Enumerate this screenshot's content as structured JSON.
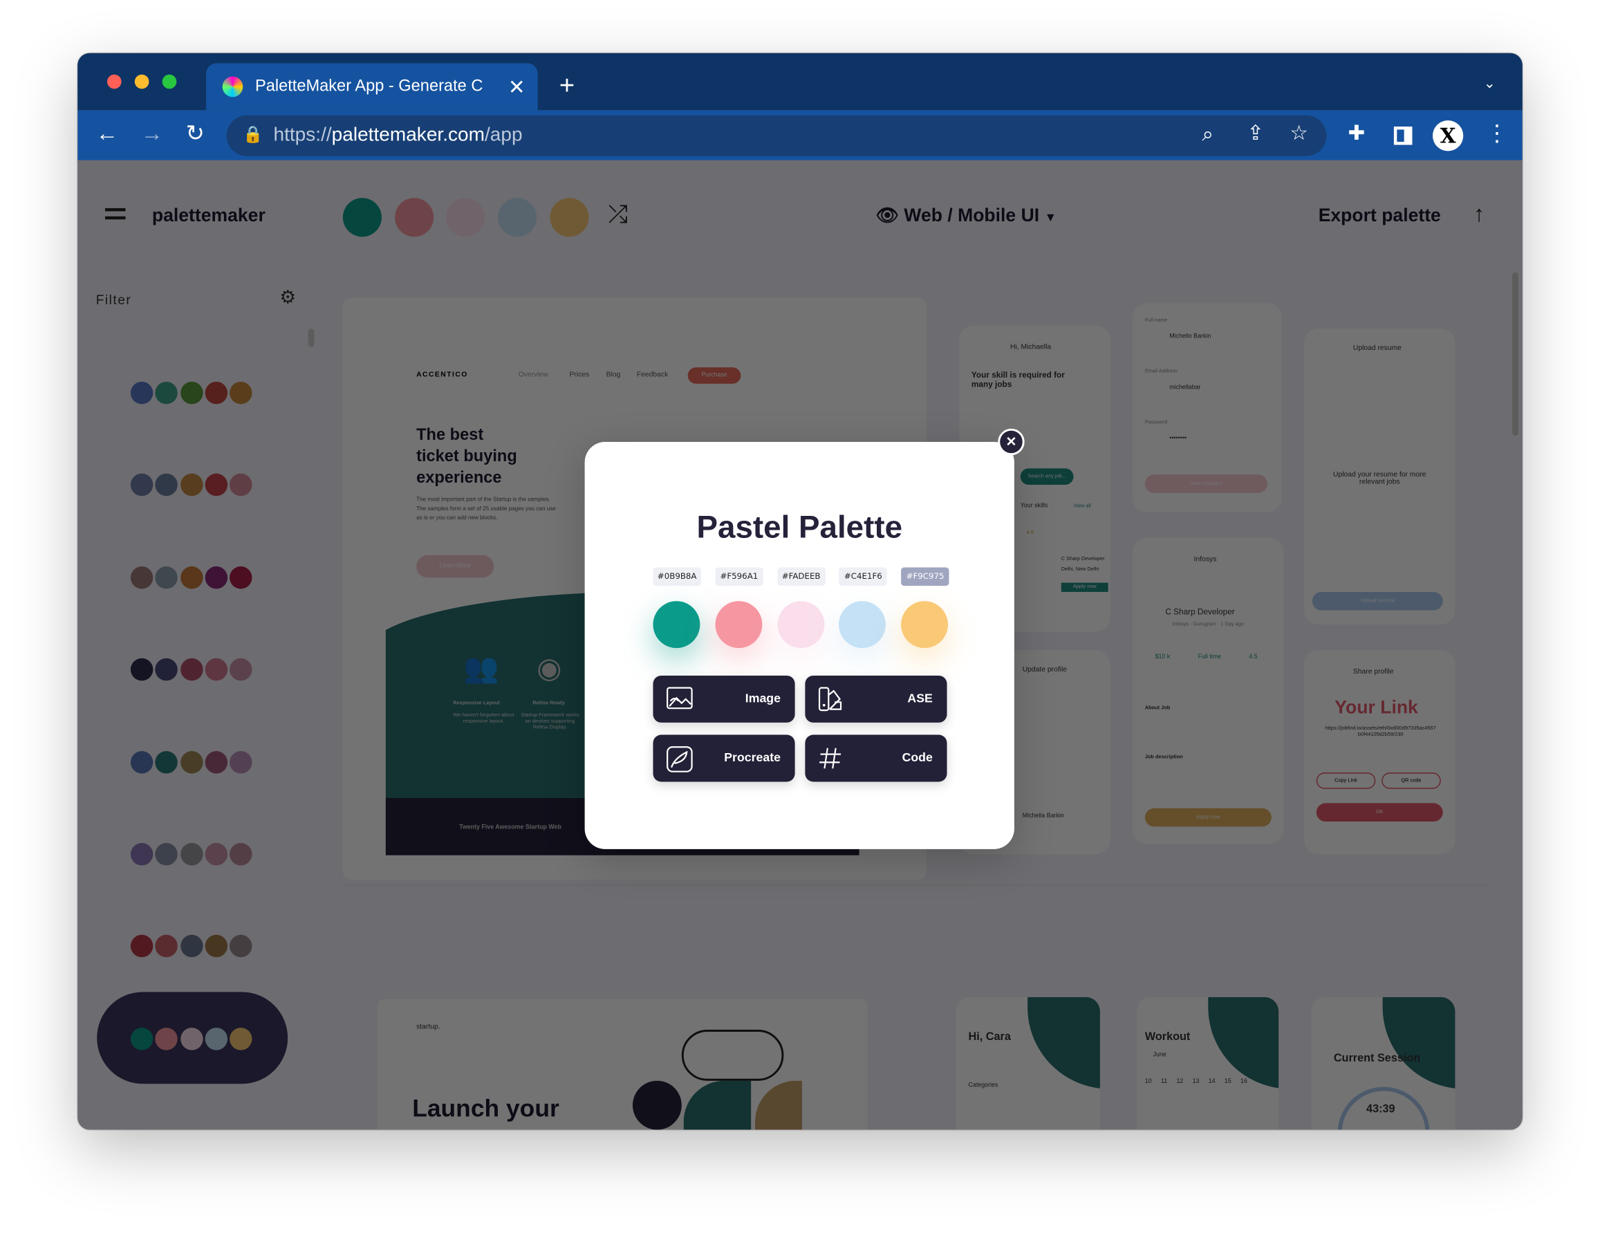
{
  "browser": {
    "tab_title": "PaletteMaker App - Generate C",
    "url_scheme": "https://",
    "url_host": "palettemaker.com",
    "url_path": "/app",
    "profile_initial": "X"
  },
  "app": {
    "logo": "palettemaker",
    "header_palette": [
      "#0B9B8A",
      "#F596A1",
      "#FADEEB",
      "#C4E1F6",
      "#F9C975"
    ],
    "mode_label": "Web / Mobile UI",
    "export_label": "Export palette",
    "filter_label": "Filter"
  },
  "sidebar": {
    "palettes": [
      [
        "#5a78c8",
        "#3fa38a",
        "#5c9a3c",
        "#c0483e",
        "#c78a3e"
      ],
      [
        "#6e7fa8",
        "#6a7f9e",
        "#c48a42",
        "#c4434a",
        "#d48a9a"
      ],
      [
        "#a07a7a",
        "#8ea0b0",
        "#c87a3a",
        "#8a2a78",
        "#a82048"
      ],
      [
        "#2c2c4c",
        "#4a4a7a",
        "#b0506a",
        "#d07890",
        "#c890a8"
      ],
      [
        "#5878b8",
        "#2a7a78",
        "#a08a5a",
        "#a05a78",
        "#b890b8"
      ],
      [
        "#8a78b8",
        "#8890a8",
        "#9a9aa0",
        "#c890a8",
        "#b88a9a"
      ],
      [
        "#b83848",
        "#c86068",
        "#6a7890",
        "#a07a48",
        "#9a8a90"
      ],
      [
        "#0B9B8A",
        "#F596A1",
        "#FADEEB",
        "#C4E1F6",
        "#F9C975"
      ]
    ]
  },
  "previews": {
    "landing": {
      "brand": "ACCENTICO",
      "nav": [
        "Overview",
        "Prices",
        "Blog",
        "Feedback"
      ],
      "cta": "Purchase",
      "headline": [
        "The best",
        "ticket buying",
        "experience"
      ],
      "body": "The most important part of the Startup is the samples. The samples form a set of 25 usable pages you can use as is or you can add new blocks.",
      "button": "Learn More",
      "feature1_title": "Responsive Layout",
      "feature1_text": "We haven't forgotten about responsive layout.",
      "feature2_title": "Retina Ready",
      "feature2_text": "Startup Framework works on devices supporting Retina Display.",
      "footer": "Twenty Five Awesome Startup Web"
    },
    "jobs_home": {
      "greeting": "Hi, Michaella",
      "headline": "Your skill is required for many jobs",
      "search": "Search any job...",
      "skills": "Your skills",
      "view_all": "View all",
      "job": "C Sharp Developer",
      "location": "Delhi, New Delhi",
      "apply": "Apply now",
      "rating": "4.5"
    },
    "profile_form": {
      "full_name_label": "Full name",
      "full_name": "Michello Barkin",
      "email_label": "Email Address",
      "email": "michellabar",
      "password_label": "Password",
      "password": "••••••••",
      "save": "Save changes"
    },
    "job_detail": {
      "company": "Infosys",
      "title": "C Sharp Developer",
      "meta": "Infosys · Gurugram · 1 Day ago",
      "salary": "$10 k",
      "type": "Full time",
      "ratings": "4.5",
      "about_job": "About Job",
      "job_description": "Job description",
      "apply": "Apply now"
    },
    "upload": {
      "title": "Upload resume",
      "headline": "Upload your resume for more relevant jobs",
      "button": "Upload resume"
    },
    "update_profile": {
      "title": "Update profile",
      "name": "Michella Barkin"
    },
    "share": {
      "title": "Share profile",
      "link_title": "Your Link",
      "link": "https://jobfind.io/assets/eth/0xd0l0d97335ac4567b0f44105d2b59/230",
      "copy": "Copy Link",
      "qr": "QR code",
      "ok": "OK"
    },
    "startup": {
      "brand": "startup.",
      "headline": "Launch your"
    },
    "fitness": {
      "greeting": "Hi, Cara",
      "categories": "Categories",
      "workout": "Workout",
      "month": "June",
      "days": [
        "10",
        "11",
        "12",
        "13",
        "14",
        "15",
        "16"
      ],
      "session": "Current Session",
      "timer": "43:39"
    }
  },
  "modal": {
    "title": "Pastel Palette",
    "colors": [
      "#0B9B8A",
      "#F596A1",
      "#FADEEB",
      "#C4E1F6",
      "#F9C975"
    ],
    "hex_labels": [
      "#0B9B8A",
      "#F596A1",
      "#FADEEB",
      "#C4E1F6",
      "#F9C975"
    ],
    "selected_index": 4,
    "buttons": [
      {
        "label": "Image",
        "icon": "image-icon"
      },
      {
        "label": "ASE",
        "icon": "swatchbook-icon"
      },
      {
        "label": "Procreate",
        "icon": "procreate-icon"
      },
      {
        "label": "Code",
        "icon": "hash-icon"
      }
    ]
  }
}
